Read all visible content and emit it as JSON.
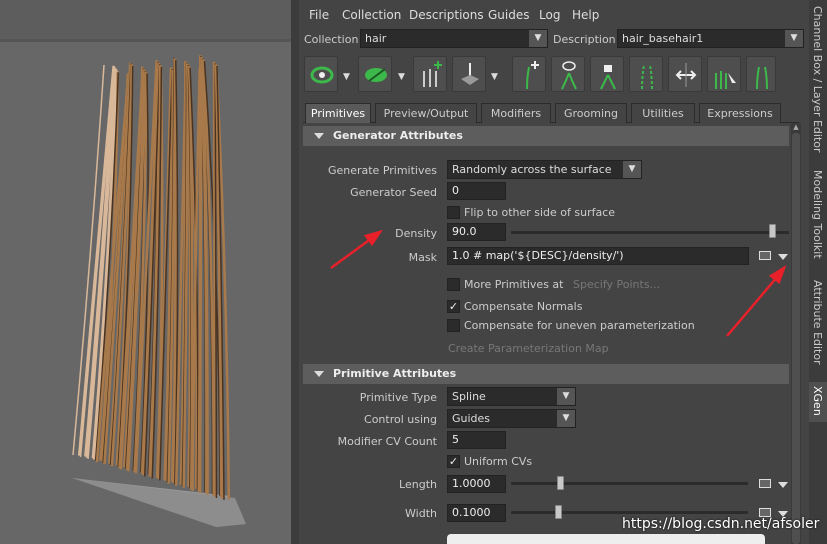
{
  "menubar": [
    "File",
    "Collection",
    "Descriptions",
    "Guides",
    "Log",
    "Help"
  ],
  "collection": {
    "label": "Collection",
    "value": "hair"
  },
  "description": {
    "label": "Description",
    "value": "hair_basehair1"
  },
  "tabs": [
    "Primitives",
    "Preview/Output",
    "Modifiers",
    "Grooming",
    "Utilities",
    "Expressions"
  ],
  "active_tab": "Primitives",
  "generator": {
    "title": "Generator Attributes",
    "gen_prim_label": "Generate Primitives",
    "gen_prim_value": "Randomly across the surface",
    "seed_label": "Generator Seed",
    "seed_value": "0",
    "flip_label": "Flip to other side of surface",
    "density_label": "Density",
    "density_value": "90.0",
    "density_level": 0.96,
    "mask_label": "Mask",
    "mask_value": "1.0 # map('${DESC}/density/')",
    "more_label": "More Primitives at",
    "specify_label": "Specify Points...",
    "comp_normals_label": "Compensate Normals",
    "comp_uneven_label": "Compensate for uneven parameterization",
    "create_map_label": "Create Parameterization Map"
  },
  "primitive": {
    "title": "Primitive Attributes",
    "type_label": "Primitive Type",
    "type_value": "Spline",
    "control_label": "Control using",
    "control_value": "Guides",
    "cv_label": "Modifier CV Count",
    "cv_value": "5",
    "uniform_label": "Uniform CVs",
    "length_label": "Length",
    "length_value": "1.0000",
    "width_label": "Width",
    "width_value": "0.1000"
  },
  "sidetabs": [
    "Channel Box / Layer Editor",
    "Modeling Toolkit",
    "Attribute Editor",
    "XGen"
  ],
  "watermark": "https://blog.csdn.net/afsoler",
  "colors": {
    "arrow": "#e8202a",
    "hair": "#a8794a",
    "hair_dark": "#4a3320"
  }
}
